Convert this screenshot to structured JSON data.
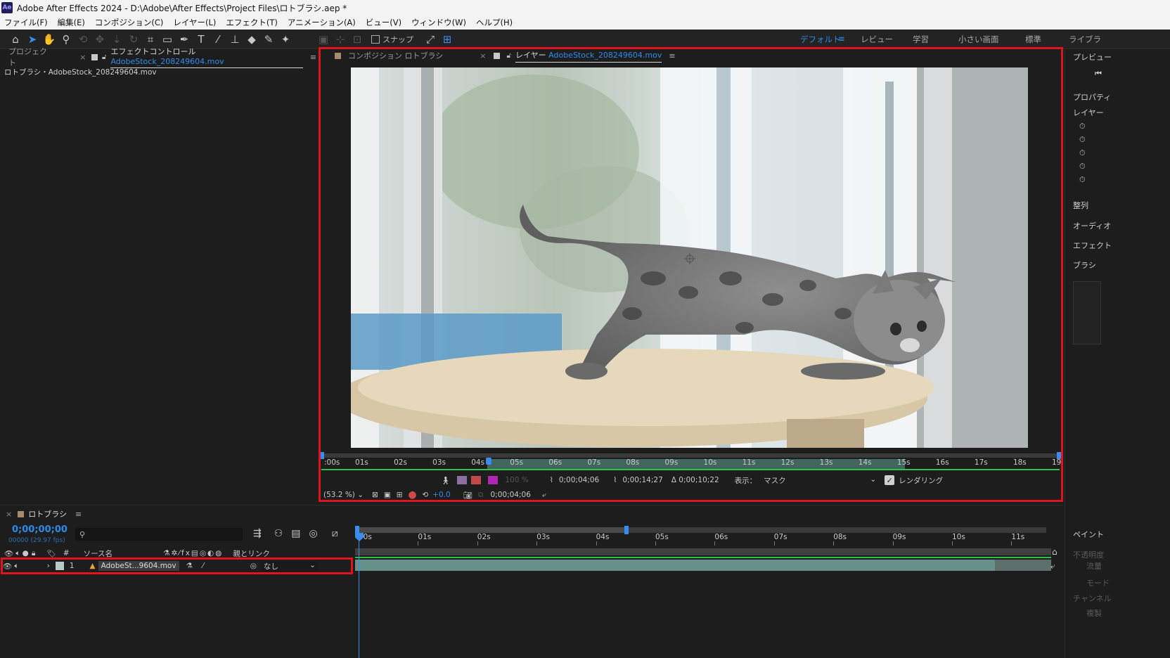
{
  "app": {
    "logo": "Ae",
    "title": "Adobe After Effects 2024 - D:\\Adobe\\After Effects\\Project Files\\ロトブラシ.aep *"
  },
  "menu": [
    "ファイル(F)",
    "編集(E)",
    "コンポジション(C)",
    "レイヤー(L)",
    "エフェクト(T)",
    "アニメーション(A)",
    "ビュー(V)",
    "ウィンドウ(W)",
    "ヘルプ(H)"
  ],
  "toolbar": {
    "snap_label": "スナップ",
    "workspaces": [
      "デフォルト",
      "レビュー",
      "学習",
      "小さい画面",
      "標準",
      "ライブラ"
    ],
    "active_workspace": "デフォルト"
  },
  "project_panel": {
    "tab_project": "プロジェクト",
    "tab_effects_prefix": "エフェクトコントロール",
    "tab_effects_file": "AdobeStock_208249604.mov",
    "breadcrumb": "ロトブラシ・AdobeStock_208249604.mov"
  },
  "viewer": {
    "tab_comp": "コンポジション ロトブラシ",
    "tab_layer_prefix": "レイヤー",
    "tab_layer_file": "AdobeStock_208249604.mov",
    "ruler_ticks": [
      ":00s",
      "01s",
      "02s",
      "03s",
      "04s",
      "05s",
      "06s",
      "07s",
      "08s",
      "09s",
      "10s",
      "11s",
      "12s",
      "13s",
      "14s",
      "15s",
      "16s",
      "17s",
      "18s",
      "19"
    ],
    "in_point": "0;00;04;06",
    "out_point": "0;00;14;27",
    "duration": "Δ 0;00;10;22",
    "view_label": "表示：",
    "view_value": "マスク",
    "render_label": "レンダリング",
    "render_checked": true,
    "zoom": "(53.2 %)",
    "exposure": "+0.0",
    "current_time": "0;00;04;06",
    "percent_label": "100 %"
  },
  "right_panel": {
    "items": [
      "プレビュー",
      "プロパティ",
      "レイヤー",
      "整列",
      "オーディオ",
      "エフェクト",
      "ブラシ",
      "ペイント",
      "不透明度",
      "流量",
      "モード",
      "チャンネル",
      "複製"
    ]
  },
  "timeline": {
    "comp_name": "ロトブラシ",
    "timecode": "0;00;00;00",
    "frame_info": "00000 (29.97 fps)",
    "search_placeholder": "",
    "col_source": "ソース名",
    "col_parent": "親とリンク",
    "col_num": "#",
    "ruler_ticks": [
      "00s",
      "01s",
      "02s",
      "03s",
      "04s",
      "05s",
      "06s",
      "07s",
      "08s",
      "09s",
      "10s",
      "11s"
    ],
    "layers": [
      {
        "num": "1",
        "name": "AdobeSt...9604.mov",
        "parent": "なし"
      }
    ]
  },
  "colors": {
    "accent": "#2d8ceb",
    "highlight": "#e0141c",
    "work_area": "#6fc0b0",
    "layer_bar": "#7fb7ad"
  }
}
